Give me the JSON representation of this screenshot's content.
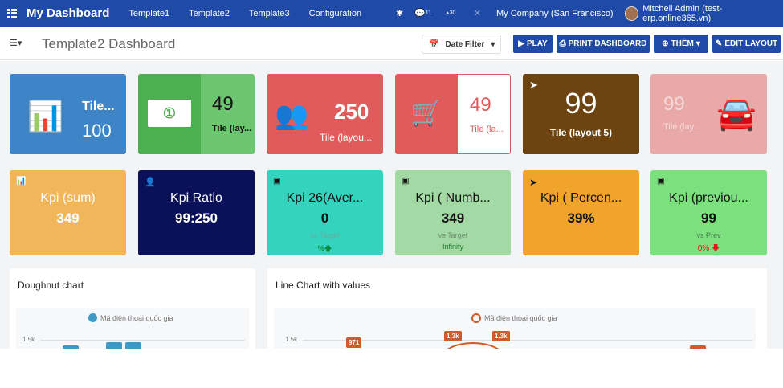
{
  "topbar": {
    "brand": "My Dashboard",
    "nav": [
      "Template1",
      "Template2",
      "Template3",
      "Configuration"
    ],
    "messages_count": "11",
    "activity_count": "30",
    "company": "My Company (San Francisco)",
    "user": "Mitchell Admin (test-erp.online365.vn)"
  },
  "control": {
    "title": "Template2 Dashboard",
    "date_filter": "Date Filter",
    "play": "PLAY",
    "print": "PRINT DASHBOARD",
    "them": "THÊM",
    "edit": "EDIT LAYOUT"
  },
  "tiles": [
    {
      "label": "Tile...",
      "value": "100",
      "color": "#3d85c6"
    },
    {
      "label": "Tile (lay...",
      "value": "49",
      "color": "#4caf50"
    },
    {
      "label": "Tile (layou...",
      "value": "250",
      "color": "#e05c5c"
    },
    {
      "label": "Tile (la...",
      "value": "49",
      "color": "#e05c5c"
    },
    {
      "label": "Tile (layout 5)",
      "value": "99",
      "color": "#6d440f"
    },
    {
      "label": "Tile (lay...",
      "value": "99",
      "color": "#eaa9a9"
    }
  ],
  "kpis": [
    {
      "label": "Kpi (sum)",
      "value": "349",
      "color": "#f1b55a"
    },
    {
      "label": "Kpi Ratio",
      "value": "99:250",
      "color": "#0a1159"
    },
    {
      "label": "Kpi 26(Aver...",
      "value": "0",
      "sub": "vs Target",
      "extra": "%",
      "color": "#33d3bd"
    },
    {
      "label": "Kpi ( Numb...",
      "value": "349",
      "sub": "vs Target",
      "extra": "Infinity",
      "color": "#a3d9a5"
    },
    {
      "label": "Kpi ( Percen...",
      "value": "39%",
      "color": "#f0a42c"
    },
    {
      "label": "Kpi (previou...",
      "value": "99",
      "sub": "vs Prev",
      "extra": "0%",
      "color": "#7de07f"
    }
  ],
  "charts": {
    "doughnut": {
      "title": "Doughnut chart",
      "legend": "Mã điện thoại quốc gia",
      "ytick": "1.5k"
    },
    "line": {
      "title": "Line Chart with values",
      "legend": "Mã điện thoại quốc gia",
      "ytick": "1.5k",
      "labels": [
        "971",
        "1.3k",
        "1.3k"
      ]
    }
  }
}
